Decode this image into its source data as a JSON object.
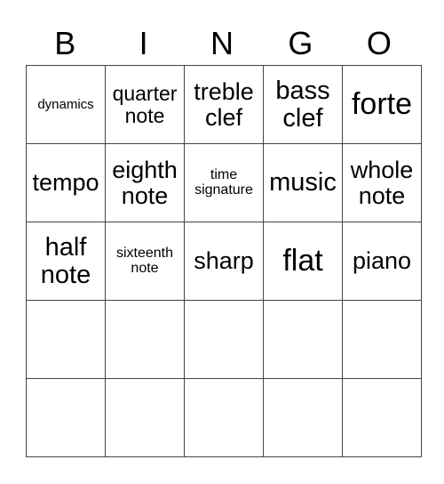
{
  "header": [
    "B",
    "I",
    "N",
    "G",
    "O"
  ],
  "rows": [
    [
      "dynamics",
      "quarter note",
      "treble clef",
      "bass clef",
      "forte"
    ],
    [
      "tempo",
      "eighth note",
      "time signature",
      "music",
      "whole note"
    ],
    [
      "half note",
      "sixteenth note",
      "sharp",
      "flat",
      "piano"
    ],
    [
      "",
      "",
      "",
      "",
      ""
    ],
    [
      "",
      "",
      "",
      "",
      ""
    ]
  ]
}
